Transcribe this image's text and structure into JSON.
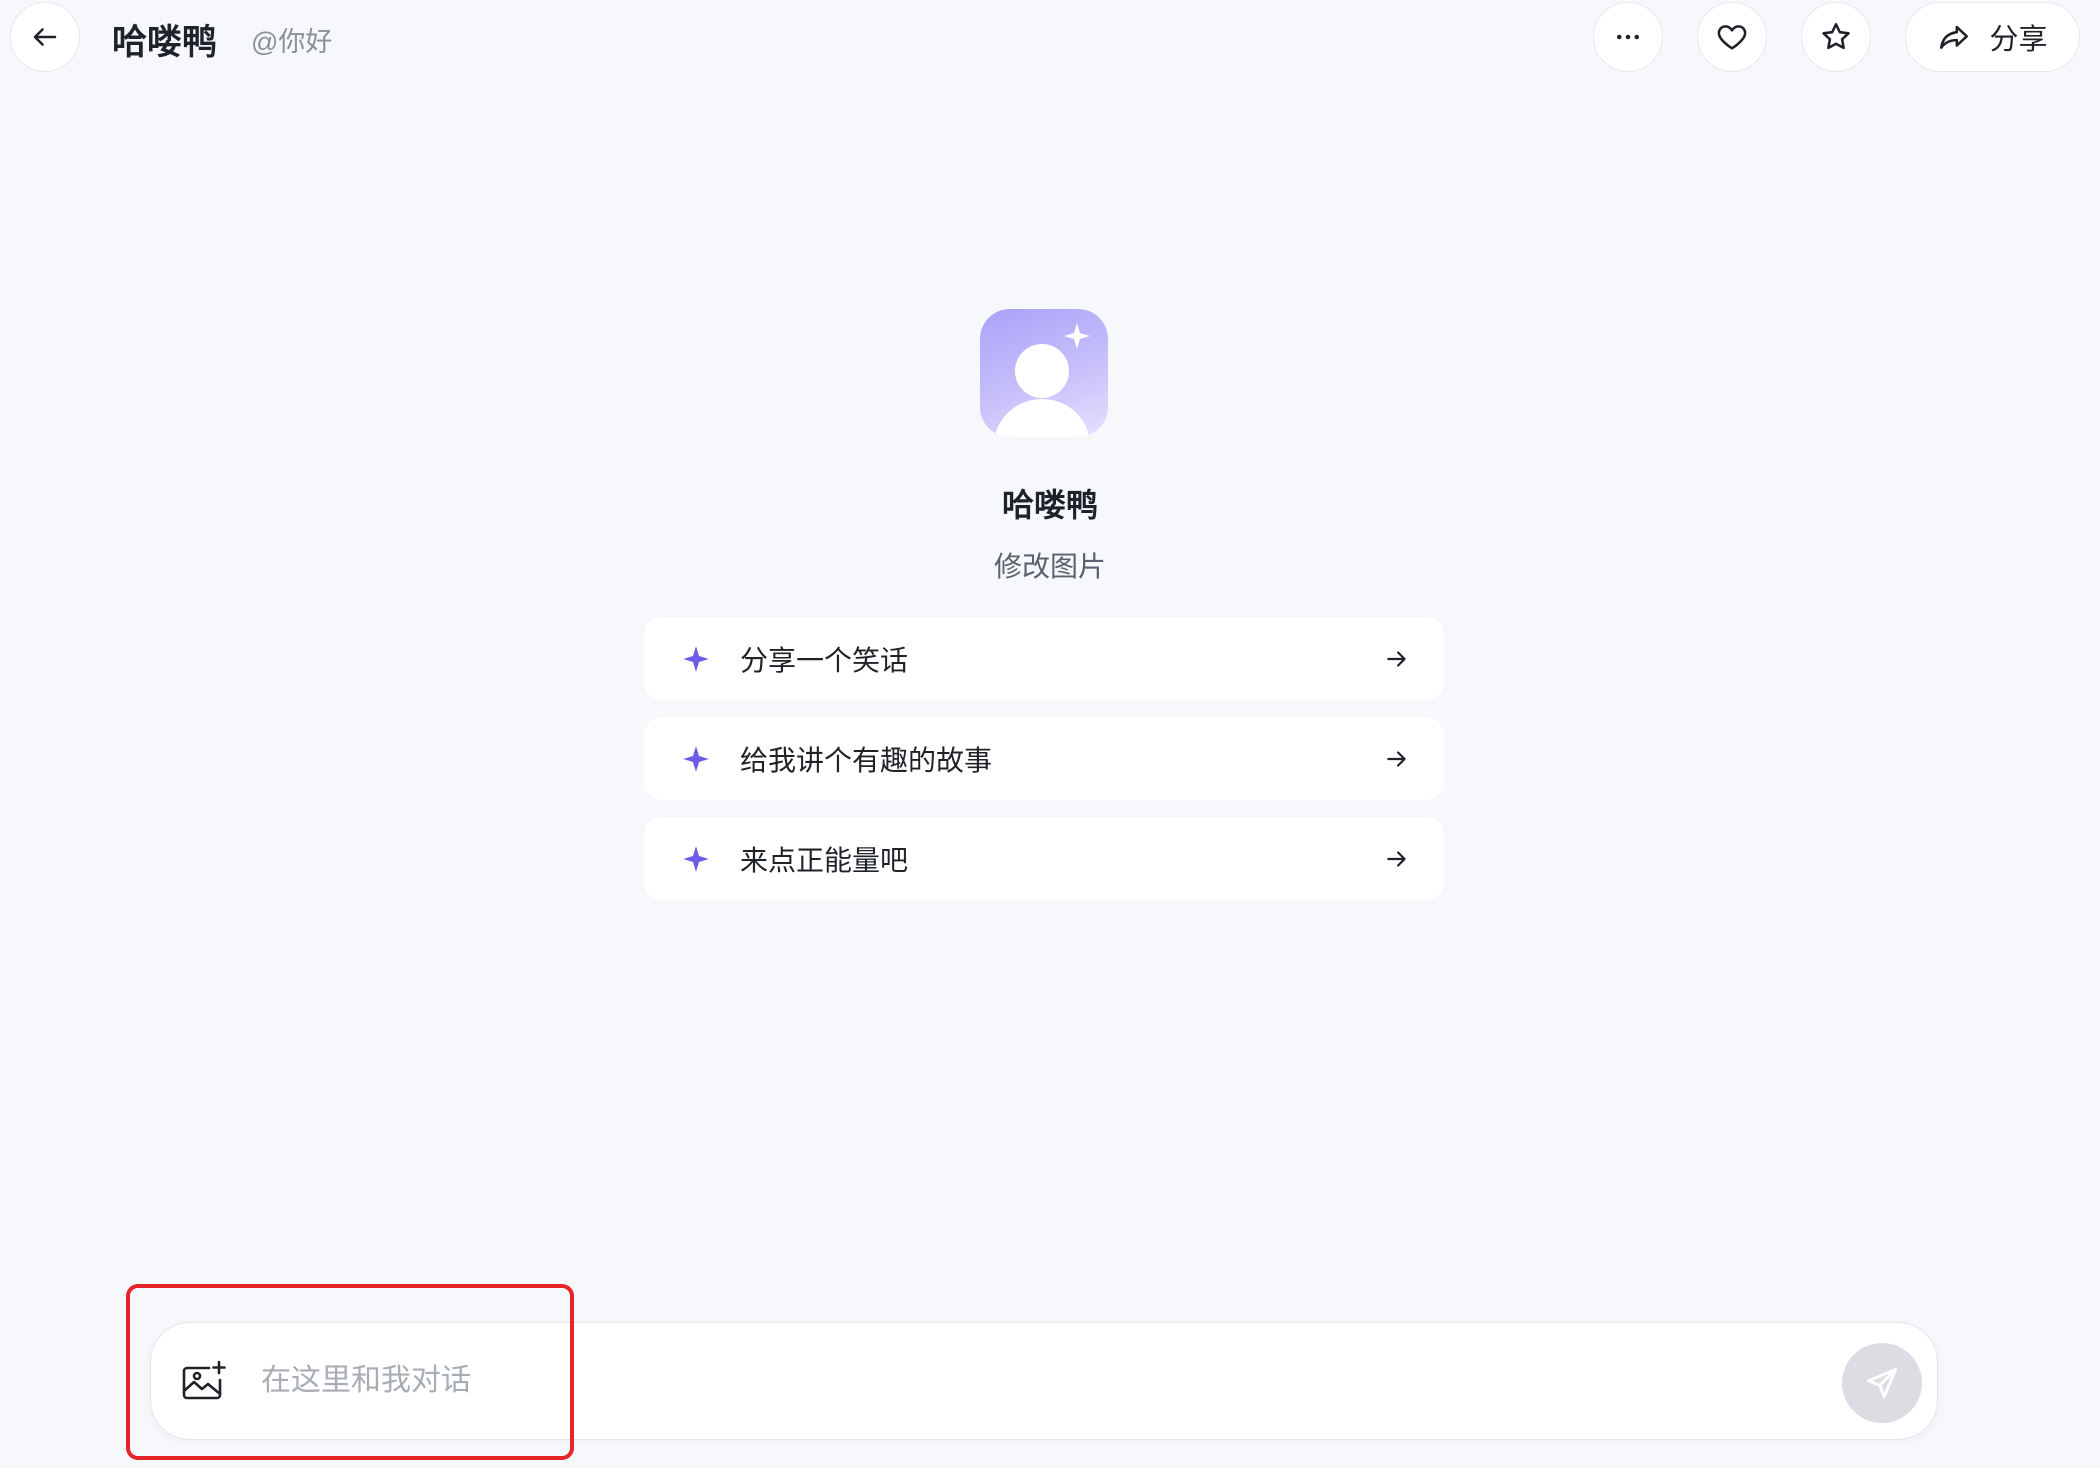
{
  "header": {
    "bot_name": "哈喽鸭",
    "bot_handle": "@你好",
    "share_label": "分享",
    "icons": {
      "back": "arrow-left-icon",
      "more": "more-horizontal-icon",
      "like": "heart-icon",
      "favorite": "star-icon",
      "share": "share-forward-icon"
    }
  },
  "profile": {
    "name": "哈喽鸭",
    "description": "修改图片",
    "avatar_icon": "default-user-avatar-icon"
  },
  "suggestions": [
    {
      "label": "分享一个笑话"
    },
    {
      "label": "给我讲个有趣的故事"
    },
    {
      "label": "来点正能量吧"
    }
  ],
  "composer": {
    "placeholder": "在这里和我对话",
    "value": "",
    "icons": {
      "upload": "image-add-icon",
      "send": "send-icon"
    }
  },
  "colors": {
    "background": "#f7f8fb",
    "accent": "#6c5ce7",
    "highlight": "#e5252a",
    "send_disabled": "#dcdde2"
  }
}
